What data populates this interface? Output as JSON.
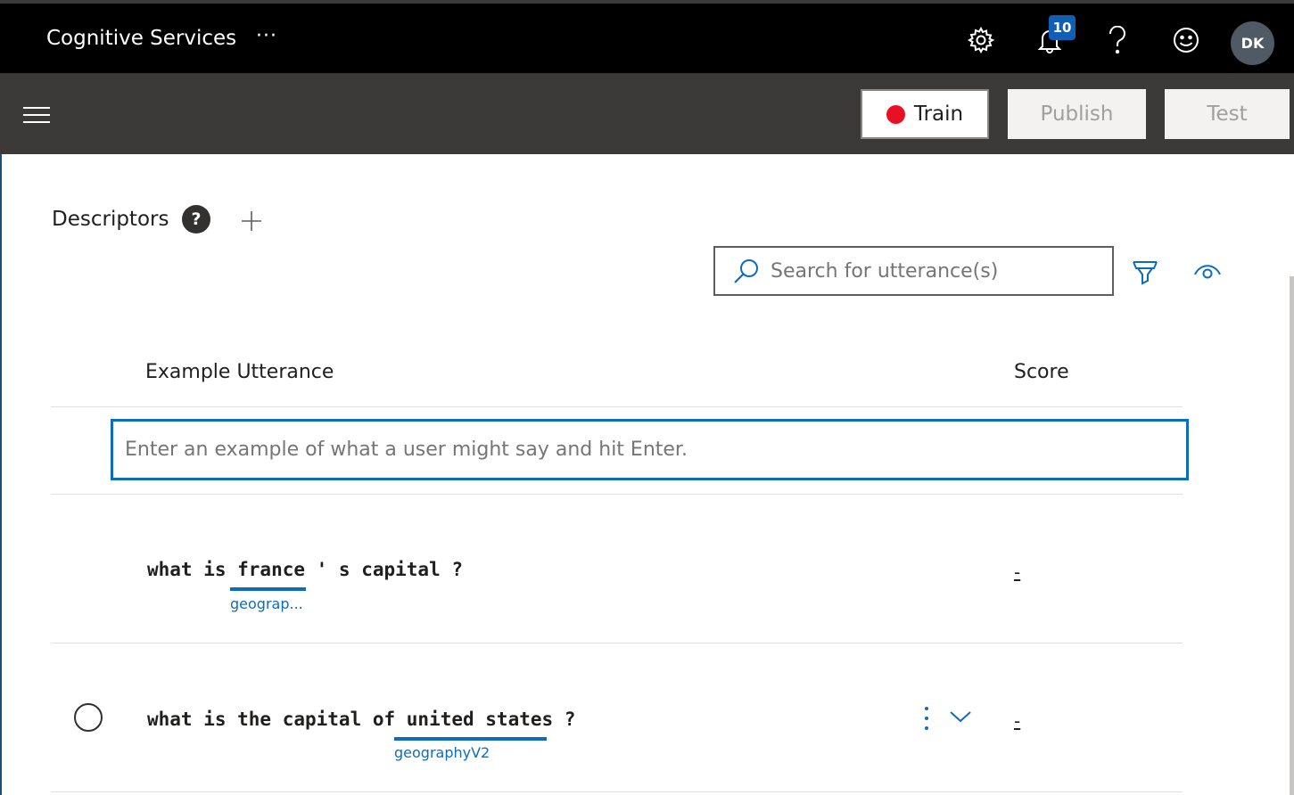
{
  "app": {
    "title": "Cognitive Services",
    "more": "···"
  },
  "top_icons": {
    "settings": "gear-icon",
    "notifications": "bell-icon",
    "notification_count": "10",
    "help": "help-icon",
    "feedback": "smiley-icon"
  },
  "user": {
    "initials": "DK"
  },
  "toolbar": {
    "train": "Train",
    "publish": "Publish",
    "test": "Test",
    "train_status_color": "#e81123"
  },
  "descriptors": {
    "title": "Descriptors",
    "help": "?"
  },
  "search": {
    "placeholder": "Search for utterance(s)"
  },
  "table": {
    "col_utterance": "Example Utterance",
    "col_score": "Score",
    "input_placeholder": "Enter an example of what a user might say and hit Enter.",
    "rows": [
      {
        "text": "what is france ' s capital ?",
        "entity_text": "france",
        "entity_label": "geograp...",
        "score": "-"
      },
      {
        "text": "what is the capital of united states ?",
        "entity_text": "united states",
        "entity_label": "geographyV2",
        "score": "-"
      }
    ]
  },
  "colors": {
    "accent": "#0f6cbd",
    "topbar": "#000000",
    "toolbar": "#3b3a39"
  }
}
